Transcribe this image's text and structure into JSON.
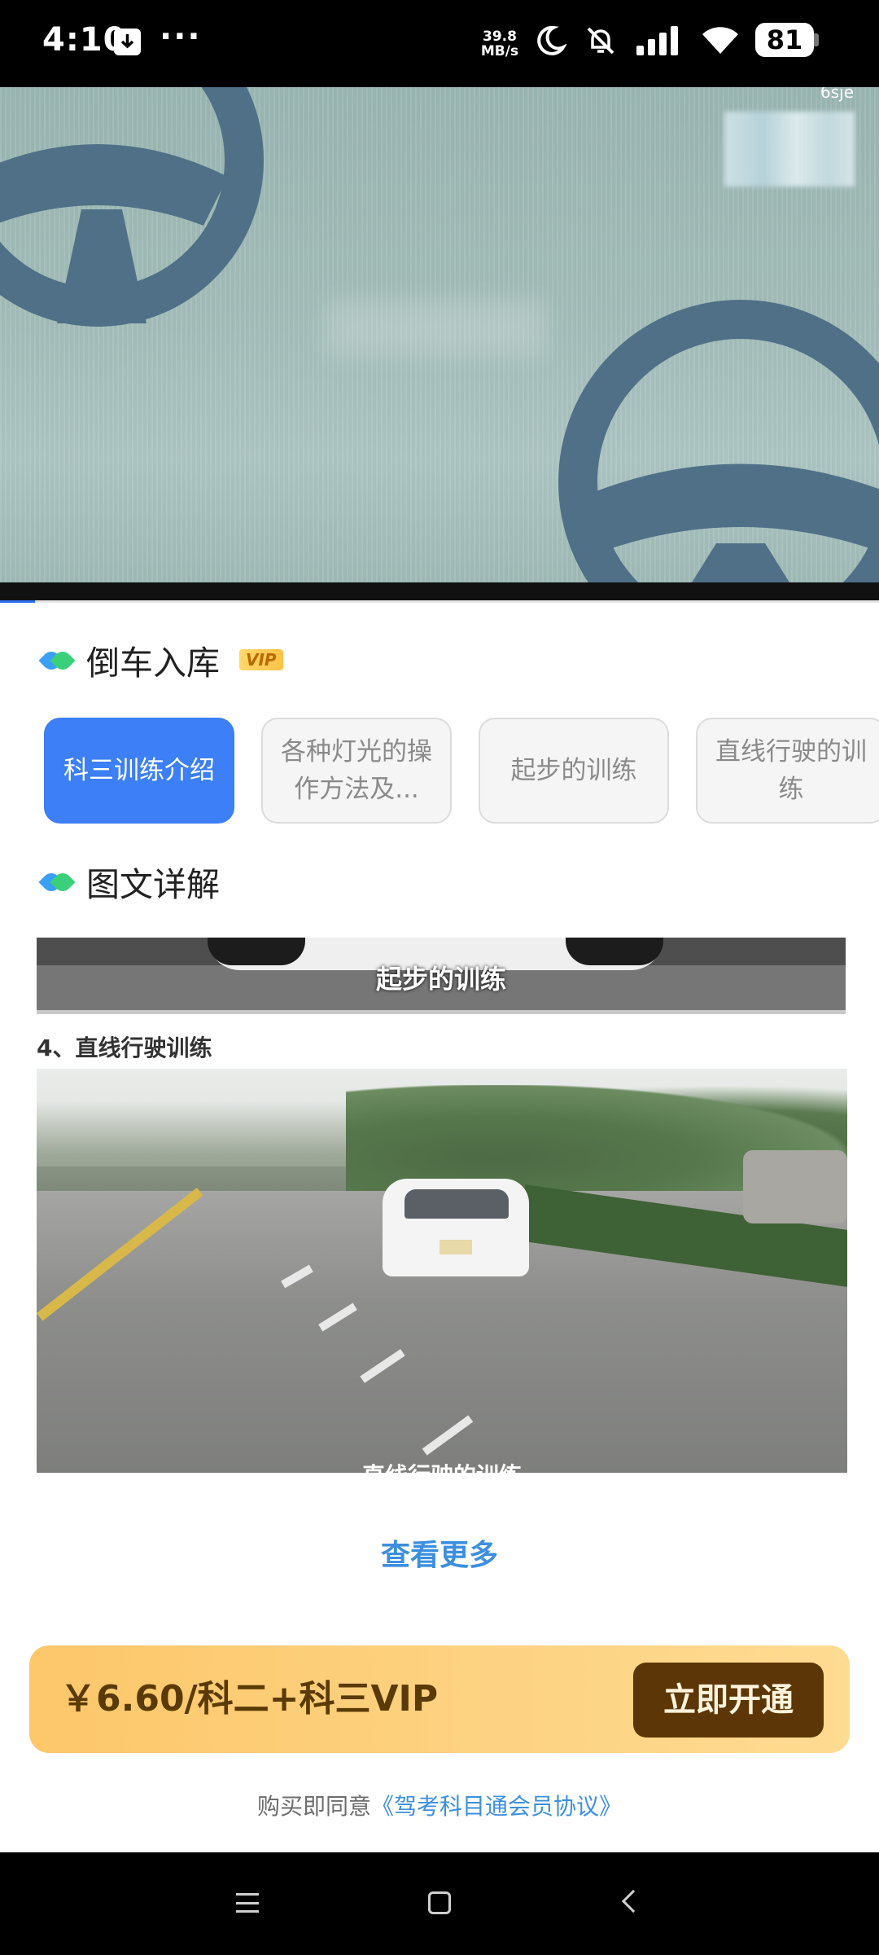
{
  "status_bar": {
    "time": "4:10",
    "more_dots": "···",
    "speed_value": "39.8",
    "speed_unit": "MB/s",
    "battery": "81"
  },
  "video": {
    "corner_label": "6sje",
    "progress_fraction": 0.04
  },
  "section1": {
    "title": "倒车入库",
    "badge": "VIP"
  },
  "chips": [
    {
      "label": "科三训练介绍",
      "active": true
    },
    {
      "label": "各种灯光的操作方法及...",
      "active": false
    },
    {
      "label": "起步的训练",
      "active": false
    },
    {
      "label": "直线行驶的训练",
      "active": false
    }
  ],
  "section2": {
    "title": "图文详解"
  },
  "content": {
    "image1_caption": "起步的训练",
    "step_title": "4、直线行驶训练",
    "image2_caption": "直线行驶的训练"
  },
  "more_label": "查看更多",
  "purchase": {
    "price": "￥6.60/科二+科三VIP",
    "button": "立即开通"
  },
  "agreement": {
    "prefix": "购买即同意",
    "link": "《驾考科目通会员协议》"
  },
  "colors": {
    "accent": "#3c7ff6",
    "link": "#3c8fe0",
    "buy_button": "#5c3606",
    "buy_bar": "#fdd383"
  }
}
